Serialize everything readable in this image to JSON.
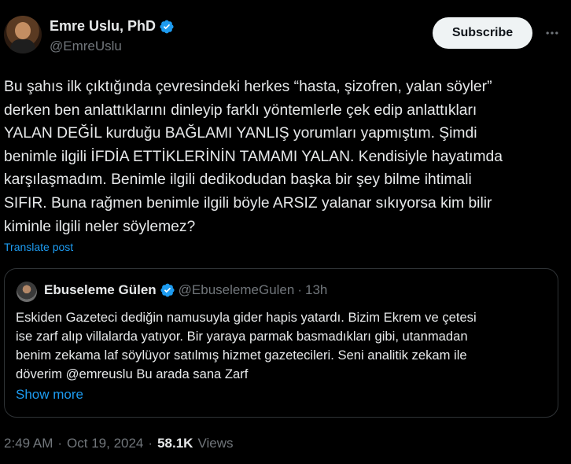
{
  "author": {
    "name": "Emre Uslu, PhD",
    "handle": "@EmreUslu",
    "verified_icon": "verified-badge-icon"
  },
  "actions": {
    "subscribe_label": "Subscribe",
    "more_icon": "more-icon"
  },
  "tweet": {
    "text": "Bu şahıs ilk çıktığında çevresindeki herkes “hasta, şizofren, yalan söyler”\nderken ben anlattıklarını dinleyip farklı yöntemlerle çek edip anlattıkları\nYALAN DEĞİL kurduğu BAĞLAMI YANLIŞ yorumları yapmıştım. Şimdi\nbenimle ilgili İFDİA ETTİKLERİNİN TAMAMI YALAN. Kendisiyle hayatımda\nkarşılaşmadım. Benimle ilgili dedikodudan başka bir şey bilme ihtimali\nSIFIR. Buna rağmen benimle ilgili böyle ARSIZ yalanar sıkıyorsa kim bilir\nkiminle ilgili neler söylemez?",
    "translate_label": "Translate post"
  },
  "quote": {
    "name": "Ebuseleme Gülen",
    "handle": "@EbuselemeGulen",
    "separator": "·",
    "time": "13h",
    "text": "Eskiden Gazeteci dediğin namusuyla gider hapis yatardı. Bizim Ekrem ve çetesi\nise zarf alıp villalarda yatıyor. Bir yaraya parmak basmadıkları gibi, utanmadan\nbenim zekama laf söylüyor satılmış hizmet gazetecileri. Seni analitik zekam ile\ndöverim @emreuslu Bu arada sana Zarf",
    "show_more_label": "Show more"
  },
  "meta": {
    "time": "2:49 AM",
    "separator1": "·",
    "date": "Oct 19, 2024",
    "separator2": "·",
    "views_count": "58.1K",
    "views_label": "Views"
  },
  "colors": {
    "background": "#000000",
    "text": "#e7e9ea",
    "muted": "#71767b",
    "accent": "#1d9bf0",
    "border": "#2f3336"
  }
}
